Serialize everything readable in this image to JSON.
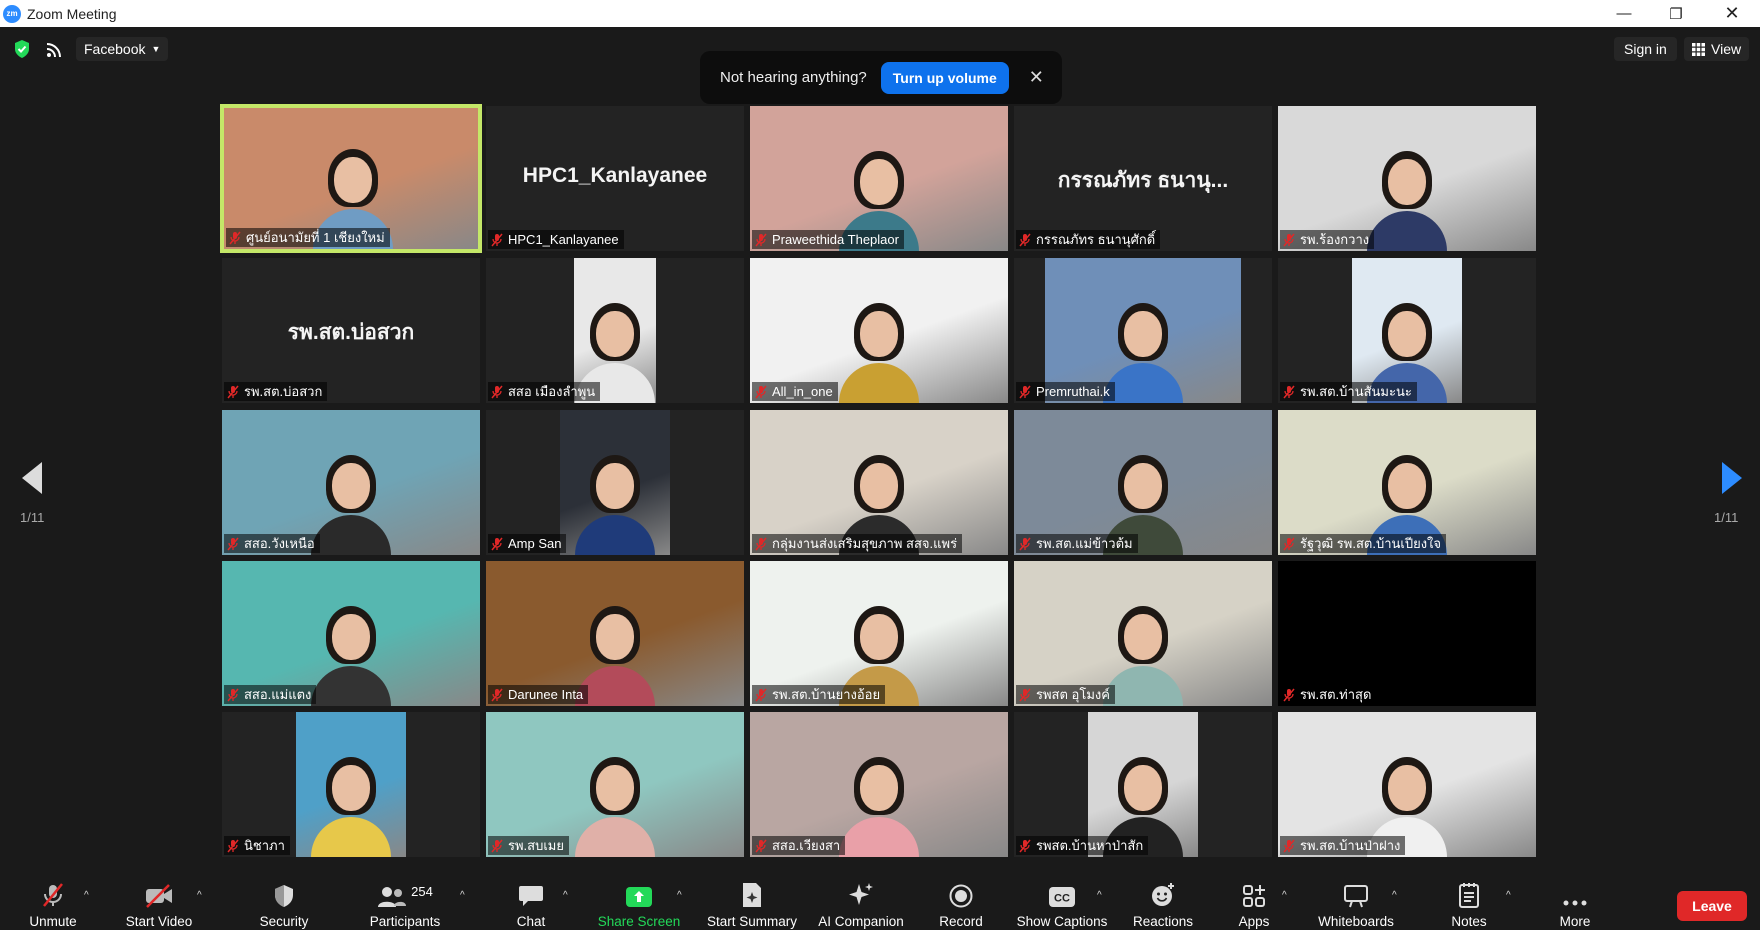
{
  "window": {
    "title": "Zoom Meeting",
    "app_icon": "zm"
  },
  "topbar": {
    "livestream_label": "Facebook",
    "signin_label": "Sign in",
    "view_label": "View"
  },
  "notice": {
    "message": "Not hearing anything?",
    "button_label": "Turn up volume"
  },
  "pagination": {
    "left": "1/11",
    "right": "1/11"
  },
  "tiles": [
    {
      "name": "ศูนย์อนามัยที่ 1 เชียงใหม่",
      "video": true,
      "active": true
    },
    {
      "name": "HPC1_Kanlayanee",
      "video": false,
      "display": "HPC1_Kanlayanee"
    },
    {
      "name": "Praweethida Theplaor",
      "video": true
    },
    {
      "name": "กรรณภัทร ธนานุศักดิ์",
      "video": false,
      "display": "กรรณภัทร ธนานุ..."
    },
    {
      "name": "รพ.ร้องกวาง",
      "video": true
    },
    {
      "name": "รพ.สต.บ่อสวก",
      "video": false,
      "display": "รพ.สต.บ่อสวก"
    },
    {
      "name": "สสอ เมืองลำพูน",
      "video": true
    },
    {
      "name": "All_in_one",
      "video": true
    },
    {
      "name": "Premruthai.k",
      "video": true
    },
    {
      "name": "รพ.สต.บ้านสันมะนะ",
      "video": true
    },
    {
      "name": "สสอ.วังเหนือ",
      "video": true
    },
    {
      "name": "Amp San",
      "video": true
    },
    {
      "name": "กลุ่มงานส่งเสริมสุขภาพ สสจ.แพร่",
      "video": true
    },
    {
      "name": "รพ.สต.แม่ข้าวต้ม",
      "video": true
    },
    {
      "name": "รัฐวุฒิ รพ.สต.บ้านเปียงใจ",
      "video": true
    },
    {
      "name": "สสอ.แม่แตง",
      "video": true
    },
    {
      "name": "Darunee Inta",
      "video": true
    },
    {
      "name": "รพ.สต.บ้านยางอ้อย",
      "video": true
    },
    {
      "name": "รพสต อุโมงค์",
      "video": true
    },
    {
      "name": "รพ.สต.ท่าสุด",
      "video": false,
      "display": ""
    },
    {
      "name": "นิชาภา",
      "video": true
    },
    {
      "name": "รพ.สบเมย",
      "video": true
    },
    {
      "name": "สสอ.เวียงสา",
      "video": true
    },
    {
      "name": "รพสต.บ้านหาป่าสัก",
      "video": true
    },
    {
      "name": "รพ.สต.บ้านป่าฝาง",
      "video": true
    }
  ],
  "toolbar": {
    "unmute": "Unmute",
    "start_video": "Start Video",
    "security": "Security",
    "participants": "Participants",
    "participants_count": "254",
    "chat": "Chat",
    "share_screen": "Share Screen",
    "start_summary": "Start Summary",
    "ai_companion": "AI Companion",
    "record": "Record",
    "show_captions": "Show Captions",
    "reactions": "Reactions",
    "apps": "Apps",
    "whiteboards": "Whiteboards",
    "notes": "Notes",
    "more": "More",
    "leave": "Leave"
  },
  "colors": {
    "accent": "#0e72ed",
    "share_green": "#23d959",
    "leave_red": "#e02828",
    "active_speaker": "#c4e768",
    "muted_red": "#e02828"
  }
}
